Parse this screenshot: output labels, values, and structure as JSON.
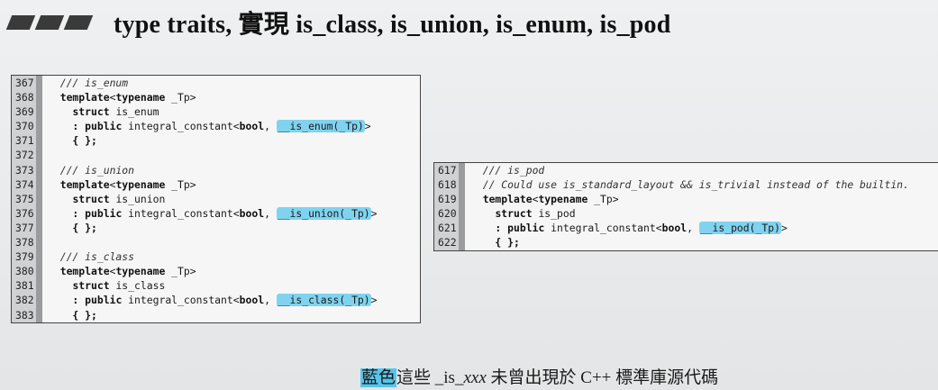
{
  "title": "type traits, 實現 is_class, is_union, is_enum, is_pod",
  "left_block": [
    {
      "ln": "367",
      "parts": [
        {
          "t": "  /// is_enum",
          "c": "cmt"
        }
      ]
    },
    {
      "ln": "368",
      "parts": [
        {
          "t": "  ",
          "c": ""
        },
        {
          "t": "template",
          "c": "kw"
        },
        {
          "t": "<",
          "c": ""
        },
        {
          "t": "typename",
          "c": "kw"
        },
        {
          "t": " _Tp>",
          "c": ""
        }
      ]
    },
    {
      "ln": "369",
      "parts": [
        {
          "t": "    ",
          "c": ""
        },
        {
          "t": "struct",
          "c": "kw"
        },
        {
          "t": " is_enum",
          "c": ""
        }
      ]
    },
    {
      "ln": "370",
      "parts": [
        {
          "t": "    : ",
          "c": "kw"
        },
        {
          "t": "public",
          "c": "kw"
        },
        {
          "t": " integral_constant<",
          "c": ""
        },
        {
          "t": "bool",
          "c": "kw"
        },
        {
          "t": ", ",
          "c": ""
        },
        {
          "t": "__is_enum(_Tp)",
          "c": "hl"
        },
        {
          "t": ">",
          "c": ""
        }
      ]
    },
    {
      "ln": "371",
      "parts": [
        {
          "t": "    { };",
          "c": "kw"
        }
      ]
    },
    {
      "ln": "372",
      "parts": [
        {
          "t": "",
          "c": ""
        }
      ]
    },
    {
      "ln": "373",
      "parts": [
        {
          "t": "  /// is_union",
          "c": "cmt"
        }
      ]
    },
    {
      "ln": "374",
      "parts": [
        {
          "t": "  ",
          "c": ""
        },
        {
          "t": "template",
          "c": "kw"
        },
        {
          "t": "<",
          "c": ""
        },
        {
          "t": "typename",
          "c": "kw"
        },
        {
          "t": " _Tp>",
          "c": ""
        }
      ]
    },
    {
      "ln": "375",
      "parts": [
        {
          "t": "    ",
          "c": ""
        },
        {
          "t": "struct",
          "c": "kw"
        },
        {
          "t": " is_union",
          "c": ""
        }
      ]
    },
    {
      "ln": "376",
      "parts": [
        {
          "t": "    : ",
          "c": "kw"
        },
        {
          "t": "public",
          "c": "kw"
        },
        {
          "t": " integral_constant<",
          "c": ""
        },
        {
          "t": "bool",
          "c": "kw"
        },
        {
          "t": ", ",
          "c": ""
        },
        {
          "t": "__is_union(_Tp)",
          "c": "hl"
        },
        {
          "t": ">",
          "c": ""
        }
      ]
    },
    {
      "ln": "377",
      "parts": [
        {
          "t": "    { };",
          "c": "kw"
        }
      ]
    },
    {
      "ln": "378",
      "parts": [
        {
          "t": "",
          "c": ""
        }
      ]
    },
    {
      "ln": "379",
      "parts": [
        {
          "t": "  /// is_class",
          "c": "cmt"
        }
      ]
    },
    {
      "ln": "380",
      "parts": [
        {
          "t": "  ",
          "c": ""
        },
        {
          "t": "template",
          "c": "kw"
        },
        {
          "t": "<",
          "c": ""
        },
        {
          "t": "typename",
          "c": "kw"
        },
        {
          "t": " _Tp>",
          "c": ""
        }
      ]
    },
    {
      "ln": "381",
      "parts": [
        {
          "t": "    ",
          "c": ""
        },
        {
          "t": "struct",
          "c": "kw"
        },
        {
          "t": " is_class",
          "c": ""
        }
      ]
    },
    {
      "ln": "382",
      "parts": [
        {
          "t": "    : ",
          "c": "kw"
        },
        {
          "t": "public",
          "c": "kw"
        },
        {
          "t": " integral_constant<",
          "c": ""
        },
        {
          "t": "bool",
          "c": "kw"
        },
        {
          "t": ", ",
          "c": ""
        },
        {
          "t": "__is_class(_Tp)",
          "c": "hl"
        },
        {
          "t": ">",
          "c": ""
        }
      ]
    },
    {
      "ln": "383",
      "parts": [
        {
          "t": "    { };",
          "c": "kw"
        }
      ]
    }
  ],
  "right_block": [
    {
      "ln": "617",
      "parts": [
        {
          "t": "  /// is_pod",
          "c": "cmt"
        }
      ]
    },
    {
      "ln": "618",
      "parts": [
        {
          "t": "  // Could use is_standard_layout && is_trivial instead of the builtin.",
          "c": "cmt"
        }
      ]
    },
    {
      "ln": "619",
      "parts": [
        {
          "t": "  ",
          "c": ""
        },
        {
          "t": "template",
          "c": "kw"
        },
        {
          "t": "<",
          "c": ""
        },
        {
          "t": "typename",
          "c": "kw"
        },
        {
          "t": " _Tp>",
          "c": ""
        }
      ]
    },
    {
      "ln": "620",
      "parts": [
        {
          "t": "    ",
          "c": ""
        },
        {
          "t": "struct",
          "c": "kw"
        },
        {
          "t": " is_pod",
          "c": ""
        }
      ]
    },
    {
      "ln": "621",
      "parts": [
        {
          "t": "    : ",
          "c": "kw"
        },
        {
          "t": "public",
          "c": "kw"
        },
        {
          "t": " integral_constant<",
          "c": ""
        },
        {
          "t": "bool",
          "c": "kw"
        },
        {
          "t": ", ",
          "c": ""
        },
        {
          "t": "__is_pod(_Tp)",
          "c": "hl"
        },
        {
          "t": ">",
          "c": ""
        }
      ]
    },
    {
      "ln": "622",
      "parts": [
        {
          "t": "    { };",
          "c": "kw"
        }
      ]
    }
  ],
  "caption": {
    "highlight": "藍色",
    "text1": "這些 _is_",
    "italic": "xxx",
    "text2": " 未曾出現於 C++ 標準庫源代碼"
  },
  "colors": {
    "highlight": "#7fd3ef",
    "caption_highlight": "#58c5ea"
  }
}
